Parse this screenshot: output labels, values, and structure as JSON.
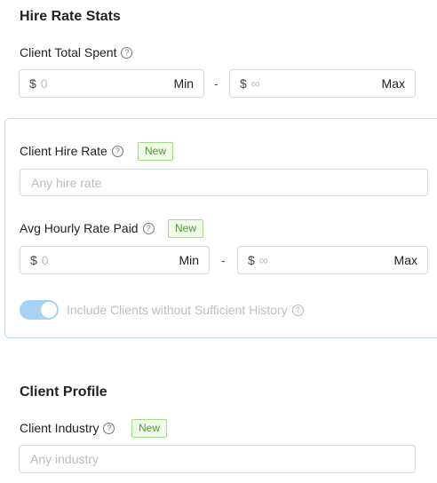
{
  "hire_rate_stats": {
    "title": "Hire Rate Stats",
    "client_total_spent": {
      "label": "Client Total Spent",
      "min": {
        "currency": "$",
        "placeholder": "0",
        "suffix": "Min"
      },
      "separator": "-",
      "max": {
        "currency": "$",
        "placeholder": "∞",
        "suffix": "Max"
      }
    }
  },
  "panel": {
    "client_hire_rate": {
      "label": "Client Hire Rate",
      "badge": "New",
      "placeholder": "Any hire rate"
    },
    "avg_hourly_rate_paid": {
      "label": "Avg Hourly Rate Paid",
      "badge": "New",
      "min": {
        "currency": "$",
        "placeholder": "0",
        "suffix": "Min"
      },
      "separator": "-",
      "max": {
        "currency": "$",
        "placeholder": "∞",
        "suffix": "Max"
      }
    },
    "include_toggle": {
      "label": "Include Clients without Sufficient History",
      "on": true
    }
  },
  "client_profile": {
    "title": "Client Profile",
    "client_industry": {
      "label": "Client Industry",
      "badge": "New",
      "placeholder": "Any industry"
    }
  },
  "icons": {
    "help": "question-circle-icon"
  },
  "colors": {
    "accent_border": "#b9e0f2",
    "badge_green": "#4f9a33",
    "toggle_on": "#a7d2f3"
  }
}
